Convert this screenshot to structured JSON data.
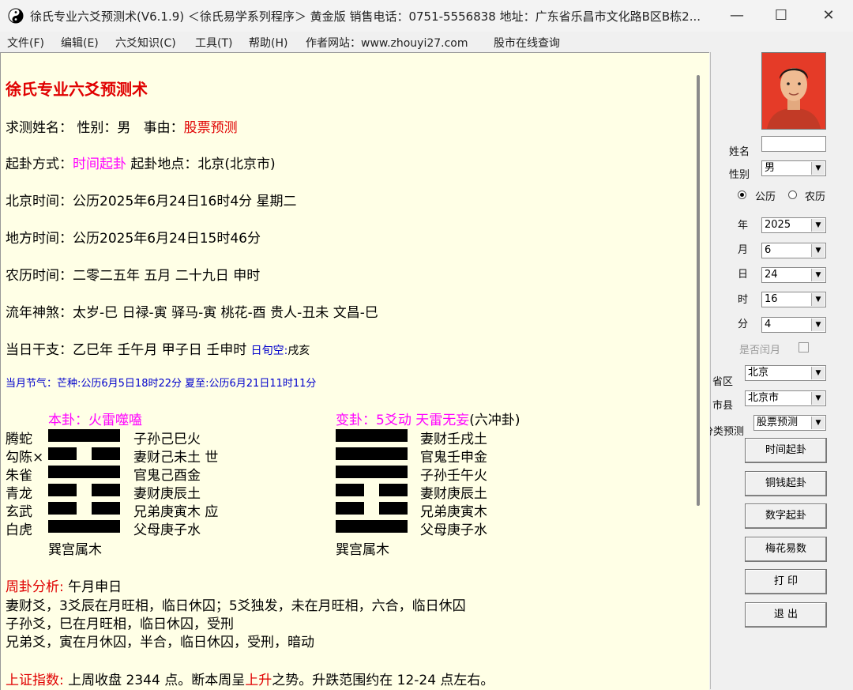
{
  "window": {
    "title": "徐氏专业六爻预测术(V6.1.9) ＜徐氏易学系列程序＞ 黄金版 销售电话：0751-5556838 地址：广东省乐昌市文化路B区B栋2...",
    "minimize": "—",
    "maximize": "☐",
    "close": "✕"
  },
  "menu": [
    "文件(F)",
    "编辑(E)",
    "六爻知识(C)",
    "工具(T)",
    "帮助(H)",
    "作者网站：www.zhouyi27.com",
    "股市在线查询"
  ],
  "report": {
    "title": "徐氏专业六爻预测术",
    "line_name_label": "求测姓名：",
    "line_gender": "性别：男",
    "line_reason_label": "事由：",
    "line_reason_value": "股票预测",
    "method_label": "起卦方式：",
    "method_value": "时间起卦",
    "place": "起卦地点：北京(北京市)",
    "beijing_time": "北京时间：公历2025年6月24日16时4分 星期二",
    "local_time": "地方时间：公历2025年6月24日15时46分",
    "lunar_time": "农历时间：二零二五年 五月 二十九日 申时",
    "shensha": "流年神煞：太岁-巳 日禄-寅 驿马-寅 桃花-酉 贵人-丑未 文昌-巳",
    "ganzhi": "当日干支：乙巳年 壬午月 甲子日 壬申时",
    "xunkong_label": "日旬空:",
    "xunkong_value": "戌亥",
    "jieqi": "当月节气：芒种:公历6月5日18时22分 夏至:公历6月21日11时11分",
    "ben_gua_title": "本卦：火雷噬嗑",
    "bian_gua_title_a": "变卦：5爻动 天雷无妄",
    "bian_gua_title_b": "(六冲卦)",
    "ben_rows": [
      {
        "beast": "腾蛇",
        "mark": "",
        "text": "子孙己巳火",
        "yang": true
      },
      {
        "beast": "勾陈",
        "mark": "×",
        "text": "妻财己未土 世",
        "yang": false
      },
      {
        "beast": "朱雀",
        "mark": "",
        "text": "官鬼己酉金",
        "yang": true
      },
      {
        "beast": "青龙",
        "mark": "",
        "text": "妻财庚辰土",
        "yang": false
      },
      {
        "beast": "玄武",
        "mark": "",
        "text": "兄弟庚寅木 应",
        "yang": false
      },
      {
        "beast": "白虎",
        "mark": "",
        "text": "父母庚子水",
        "yang": true
      }
    ],
    "bian_rows": [
      {
        "text": "妻财壬戌土",
        "yang": true
      },
      {
        "text": "官鬼壬申金",
        "yang": true
      },
      {
        "text": "子孙壬午火",
        "yang": true
      },
      {
        "text": "妻财庚辰土",
        "yang": false
      },
      {
        "text": "兄弟庚寅木",
        "yang": false
      },
      {
        "text": "父母庚子水",
        "yang": true
      }
    ],
    "ben_palace": "巽宫属木",
    "bian_palace": "巽宫属木",
    "week_label": "周卦分析:",
    "week_value": "午月申日",
    "analysis": [
      "妻财爻，3爻辰在月旺相，临日休囚；5爻独发，未在月旺相，六合，临日休囚",
      "子孙爻，巳在月旺相，临日休囚，受刑",
      "兄弟爻，寅在月休囚，半合，临日休囚，受刑，暗动"
    ],
    "index_label": "上证指数:",
    "index_a": "上周收盘 2344 点。断本周呈",
    "index_up": "上升",
    "index_b": "之势。升跌范围约在 12-24 点左右。"
  },
  "panel": {
    "name_label": "姓名",
    "name_value": "",
    "gender_label": "性别",
    "gender_value": "男",
    "calendar_solar": "公历",
    "calendar_lunar": "农历",
    "calendar_selected": "公历",
    "year_label": "年",
    "year_value": "2025",
    "month_label": "月",
    "month_value": "6",
    "day_label": "日",
    "day_value": "24",
    "hour_label": "时",
    "hour_value": "16",
    "minute_label": "分",
    "minute_value": "4",
    "leap_label": "是否闰月",
    "province_label": "省区",
    "province_value": "北京",
    "city_label": "市县",
    "city_value": "北京市",
    "category_label": "分类预测",
    "category_value": "股票预测",
    "buttons": [
      "时间起卦",
      "铜钱起卦",
      "数字起卦",
      "梅花易数",
      "打 印",
      "退 出"
    ]
  }
}
